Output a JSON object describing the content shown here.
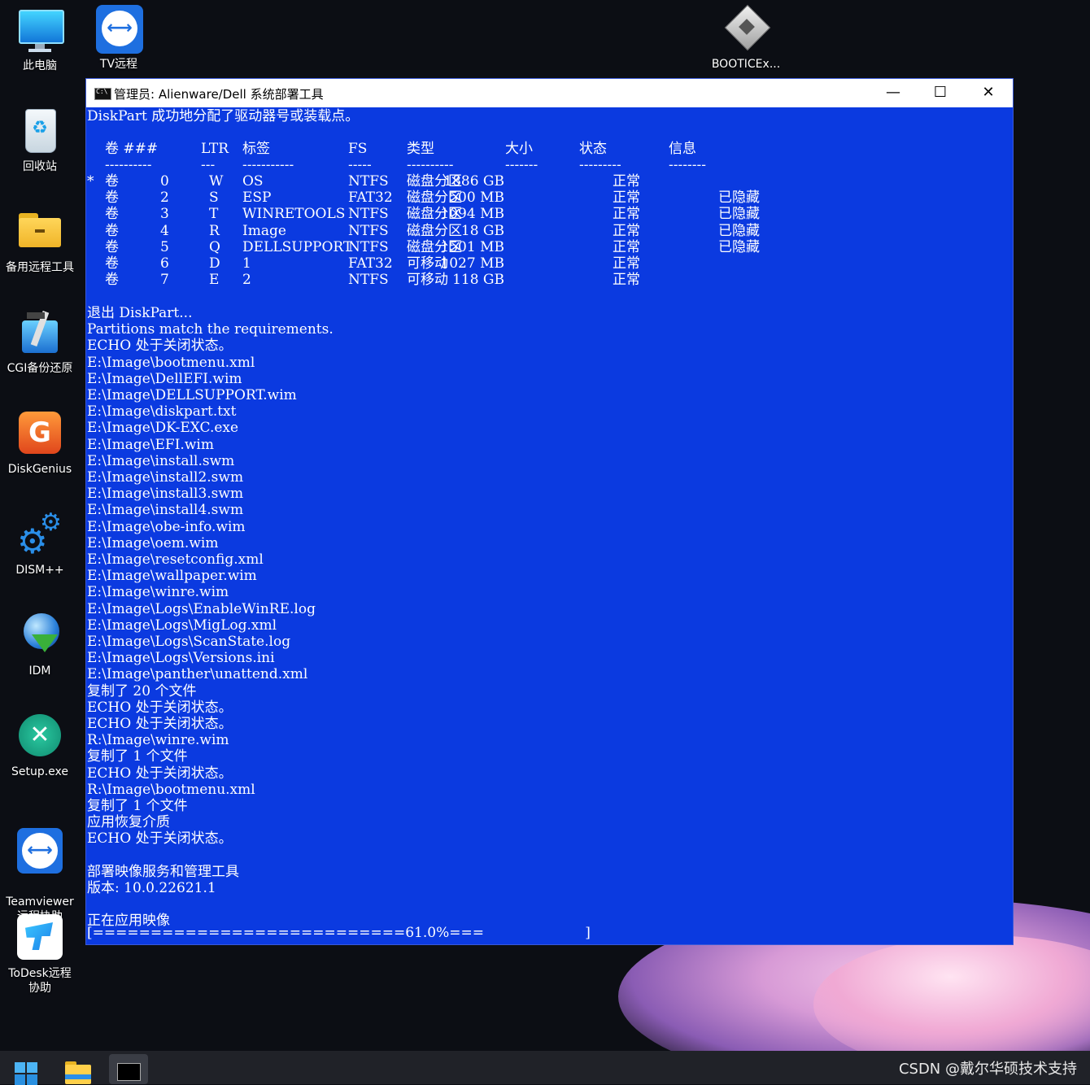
{
  "desktop": {
    "icons": [
      {
        "label": "此电脑"
      },
      {
        "label": "回收站"
      },
      {
        "label": "备用远程工具"
      },
      {
        "label": "CGI备份还原"
      },
      {
        "label": "DiskGenius"
      },
      {
        "label": "DISM++"
      },
      {
        "label": "IDM"
      },
      {
        "label": "Setup.exe"
      },
      {
        "label": "Teamviewer\n远程协助"
      },
      {
        "label": "ToDesk远程\n协助"
      },
      {
        "label": "TV远程"
      },
      {
        "label": "BOOTICEx..."
      }
    ]
  },
  "window": {
    "title": "管理员:  Alienware/Dell 系统部署工具",
    "minimize": "—",
    "maximize": "☐",
    "close": "✕"
  },
  "console": {
    "intro": "DiskPart 成功地分配了驱动器号或装载点。",
    "headers": [
      "卷 ###",
      "LTR",
      "标签",
      "FS",
      "类型",
      "大小",
      "状态",
      "信息"
    ],
    "dashes": [
      "----------",
      "---",
      "-----------",
      "-----",
      "----------",
      "-------",
      "---------",
      "--------"
    ],
    "volumes": [
      {
        "sel": "*",
        "vol": "卷",
        "num": "0",
        "ltr": "W",
        "label": "OS",
        "fs": "NTFS",
        "type": "磁盘分区",
        "size": "1886 GB",
        "status": "正常",
        "info": ""
      },
      {
        "sel": "",
        "vol": "卷",
        "num": "2",
        "ltr": "S",
        "label": "ESP",
        "fs": "FAT32",
        "type": "磁盘分区",
        "size": "500 MB",
        "status": "正常",
        "info": "已隐藏"
      },
      {
        "sel": "",
        "vol": "卷",
        "num": "3",
        "ltr": "T",
        "label": "WINRETOOLS",
        "fs": "NTFS",
        "type": "磁盘分区",
        "size": "1094 MB",
        "status": "正常",
        "info": "已隐藏"
      },
      {
        "sel": "",
        "vol": "卷",
        "num": "4",
        "ltr": "R",
        "label": "Image",
        "fs": "NTFS",
        "type": "磁盘分区",
        "size": "18 GB",
        "status": "正常",
        "info": "已隐藏"
      },
      {
        "sel": "",
        "vol": "卷",
        "num": "5",
        "ltr": "Q",
        "label": "DELLSUPPORT",
        "fs": "NTFS",
        "type": "磁盘分区",
        "size": "1501 MB",
        "status": "正常",
        "info": "已隐藏"
      },
      {
        "sel": "",
        "vol": "卷",
        "num": "6",
        "ltr": "D",
        "label": "1",
        "fs": "FAT32",
        "type": "可移动",
        "size": "1027 MB",
        "status": "正常",
        "info": ""
      },
      {
        "sel": "",
        "vol": "卷",
        "num": "7",
        "ltr": "E",
        "label": "2",
        "fs": "NTFS",
        "type": "可移动",
        "size": "118 GB",
        "status": "正常",
        "info": ""
      }
    ],
    "lines": [
      "退出 DiskPart...",
      "Partitions match the requirements.",
      "ECHO 处于关闭状态。",
      "E:\\Image\\bootmenu.xml",
      "E:\\Image\\DellEFI.wim",
      "E:\\Image\\DELLSUPPORT.wim",
      "E:\\Image\\diskpart.txt",
      "E:\\Image\\DK-EXC.exe",
      "E:\\Image\\EFI.wim",
      "E:\\Image\\install.swm",
      "E:\\Image\\install2.swm",
      "E:\\Image\\install3.swm",
      "E:\\Image\\install4.swm",
      "E:\\Image\\obe-info.wim",
      "E:\\Image\\oem.wim",
      "E:\\Image\\resetconfig.xml",
      "E:\\Image\\wallpaper.wim",
      "E:\\Image\\winre.wim",
      "E:\\Image\\Logs\\EnableWinRE.log",
      "E:\\Image\\Logs\\MigLog.xml",
      "E:\\Image\\Logs\\ScanState.log",
      "E:\\Image\\Logs\\Versions.ini",
      "E:\\Image\\panther\\unattend.xml",
      "复制了 20 个文件",
      "ECHO 处于关闭状态。",
      "ECHO 处于关闭状态。",
      "R:\\Image\\winre.wim",
      "复制了 1 个文件",
      "ECHO 处于关闭状态。",
      "R:\\Image\\bootmenu.xml",
      "复制了 1 个文件",
      "应用恢复介质",
      "ECHO 处于关闭状态。",
      "",
      "部署映像服务和管理工具",
      "版本: 10.0.22621.1",
      "",
      "正在应用映像"
    ],
    "progress_text": "[===========================61.0%===                       ]",
    "progress_percent": 61.0
  },
  "taskbar": {
    "items": [
      {
        "name": "start"
      },
      {
        "name": "file-explorer"
      },
      {
        "name": "command-prompt"
      }
    ]
  },
  "watermark": "CSDN @戴尔华硕技术支持"
}
